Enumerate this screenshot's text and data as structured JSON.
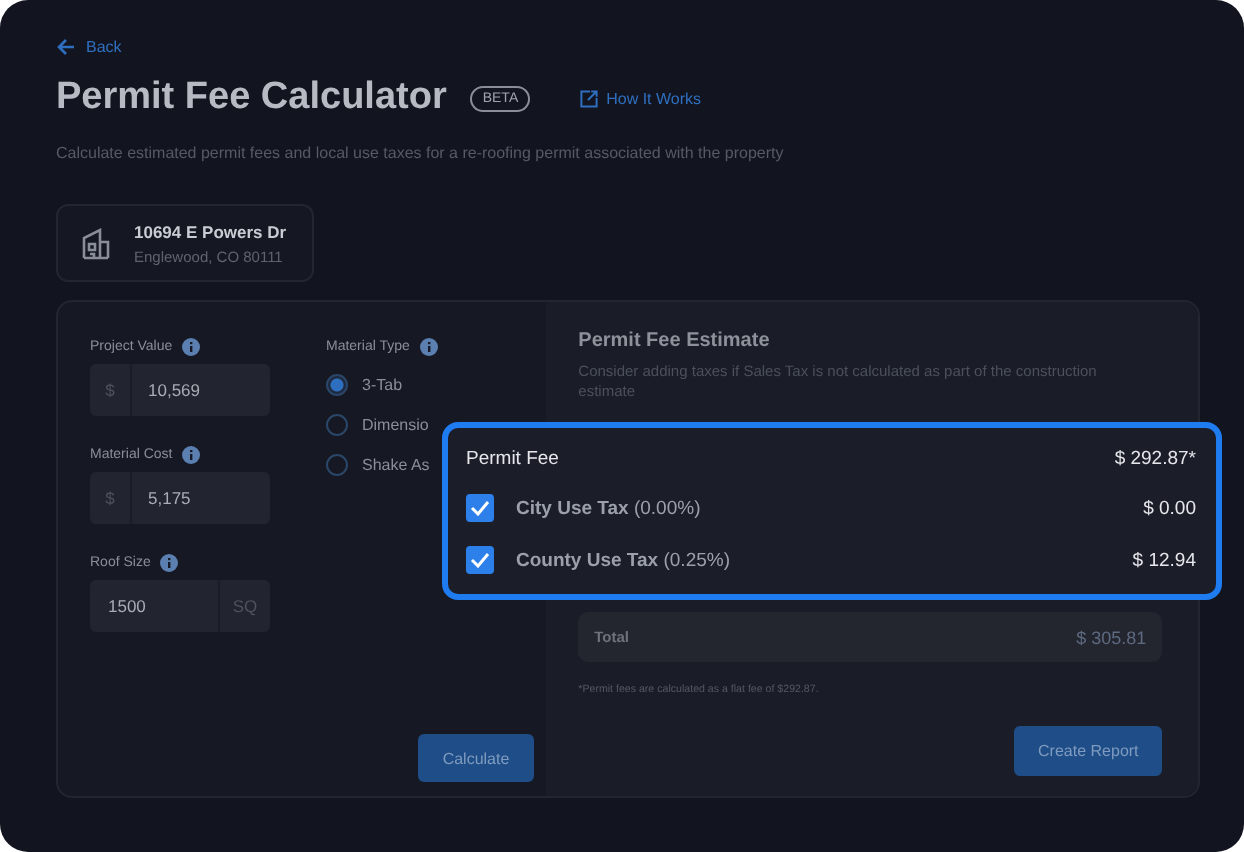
{
  "back": "Back",
  "title": "Permit Fee Calculator",
  "badge": "BETA",
  "how_it_works": "How It Works",
  "description": "Calculate estimated permit fees and local use taxes for a re-roofing permit associated with the property",
  "address": {
    "line1": "10694 E Powers Dr",
    "line2": "Englewood, CO 80111"
  },
  "inputs": [
    {
      "label": "Project Value",
      "prefix": "$",
      "value": "10,569"
    },
    {
      "label": "Material Cost",
      "prefix": "$",
      "value": "5,175"
    },
    {
      "label": "Roof Size",
      "value": "1500",
      "suffix": "SQ"
    }
  ],
  "material_type": {
    "label": "Material Type",
    "options": [
      {
        "label": "3-Tab",
        "selected": true
      },
      {
        "label": "Dimensio",
        "selected": false
      },
      {
        "label": "Shake As",
        "selected": false
      }
    ]
  },
  "calculate": "Calculate",
  "estimate": {
    "title": "Permit Fee Estimate",
    "description": "Consider adding taxes if Sales Tax is not calculated as part of the construction estimate",
    "total": {
      "label": "Total",
      "value": "$ 305.81"
    },
    "footnote": "*Permit fees are calculated as a flat fee of $292.87.",
    "button": "Create Report"
  },
  "popup": {
    "fee": {
      "label": "Permit Fee",
      "value": "$ 292.87*"
    },
    "taxes": [
      {
        "label": "City Use Tax",
        "rate": "(0.00%)",
        "value": "$ 0.00",
        "checked": true
      },
      {
        "label": "County Use Tax",
        "rate": "(0.25%)",
        "value": "$ 12.94",
        "checked": true
      }
    ]
  }
}
